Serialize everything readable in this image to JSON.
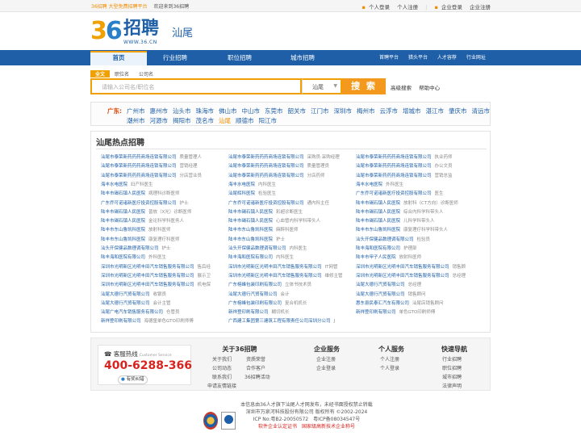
{
  "topbar": {
    "promo": "36招聘 大型免费招聘平台",
    "welcome": "欢迎来到36招聘",
    "personal_login": "个人登录",
    "personal_register": "个人注册",
    "company_login": "企业登录",
    "company_register": "企业注册"
  },
  "logo": {
    "cn": "招聘",
    "url": "WWW.36.CN"
  },
  "city": "汕尾",
  "nav": {
    "tabs": [
      "首页",
      "行业招聘",
      "职位招聘",
      "城市招聘"
    ],
    "right": [
      "首聘平台",
      "猎头平台",
      "人才容荐",
      "行业网址"
    ]
  },
  "search": {
    "tabs": [
      "全文",
      "职位名",
      "公司名"
    ],
    "placeholder": "请输入公司名/职位名",
    "city": "汕尾",
    "button": "搜 索",
    "advanced": "高级搜索",
    "assist": "帮助中心"
  },
  "cities": {
    "label": "广东:",
    "row1": [
      "广州市",
      "惠州市",
      "汕头市",
      "珠海市",
      "佛山市",
      "中山市",
      "东莞市",
      "韶关市",
      "江门市",
      "深圳市",
      "梅州市",
      "云浮市",
      "增城市",
      "湛江市",
      "肇庆市",
      "清远市"
    ],
    "row2": [
      "潮州市",
      "河源市",
      "揭阳市",
      "茂名市",
      "汕尾",
      "顺德市",
      "阳江市"
    ]
  },
  "hot": {
    "title": "汕尾热点招聘",
    "col1": [
      [
        "汕尾市泰荣新药药药商场连锁有限公司",
        "质量管理人"
      ],
      [
        "汕尾市泰荣新药药药商场连锁有限公司",
        "营销经理"
      ],
      [
        "汕尾市泰荣新药药药商场连锁有限公司",
        "分店营业员"
      ],
      [
        "海丰水电医院",
        "妇产科医生"
      ],
      [
        "陆丰市碣石镇人民医院",
        "病理科诊断医师"
      ],
      [
        "广东乔可诺诸新医疗投资控股有限公司",
        "护士"
      ],
      [
        "陆丰市碣石镇人民医院",
        "普放（X光）诊断医师"
      ],
      [
        "陆丰市碣石镇人民医院",
        "金论科学科医务人"
      ],
      [
        "陆丰市东山鲁凯科医院",
        "放射科医师"
      ],
      [
        "陆丰市东山鲁凯科医院",
        "康复理疗科医师"
      ],
      [
        "汕头开保健品数理调有限公司",
        "护士"
      ],
      [
        "陆丰海和医院有限公司",
        "外科医生"
      ],
      [
        "深圳市光明新区光明丰田汽车销售服务有限公司",
        "售后经"
      ],
      [
        "深圳市光明新区光明丰田汽车销售服务有限公司",
        "展示卫"
      ],
      [
        "深圳市光明新区光明丰田汽车销售服务有限公司",
        "机电保"
      ],
      [
        "汕尾大德行汽贸有限公司",
        "收银员"
      ],
      [
        "汕尾大德行汽贸有限公司",
        "会计主管"
      ],
      [
        "汕尾广电汽车销售服务有限公司",
        "仓管员"
      ],
      [
        "新祥登印刷有限公司",
        "海德堡单色GTO印刷师傅"
      ]
    ],
    "col2": [
      [
        "汕尾市泰荣新药药药商场连锁有限公司",
        "采购员·采购经理"
      ],
      [
        "汕尾市泰荣新药药药商场连锁有限公司",
        "质量管理员"
      ],
      [
        "汕尾市泰荣新药药药商场连锁有限公司",
        "分店药师"
      ],
      [
        "海丰水电医院",
        "内科医生"
      ],
      [
        "汕尾辉科医院",
        "检验医生"
      ],
      [
        "广东乔可诺诸新医疗投资控股有限公司",
        "通内科主任"
      ],
      [
        "陆丰市碣石镇人民医院",
        "彩超诊断医生"
      ],
      [
        "陆丰市碣石镇人民医院",
        "心血管内科学科带头人"
      ],
      [
        "陆丰市东山鲁凯科医院",
        "麻醉科医师"
      ],
      [
        "陆丰市东山鲁凯科医院",
        "护士"
      ],
      [
        "汕头开保健品数理调有限公司",
        "内科医生"
      ],
      [
        "陆丰海和医院有限公司",
        "内科医生"
      ],
      [
        "深圳市光明新区光明丰田汽车销售服务有限公司",
        "IT网管"
      ],
      [
        "深圳市光明新区光明丰田汽车销售服务有限公司",
        "维修主管"
      ],
      [
        "广东榕峰包装印刷有限公司",
        "立体书技术员"
      ],
      [
        "汕尾大德行汽贸有限公司",
        "会计"
      ],
      [
        "广东榕峰包装印刷有限公司",
        "复合机机长"
      ],
      [
        "新祥登印刷有限公司",
        "糊切机长"
      ],
      [
        "广西建工集团第三建筑工程有限责任公司深圳分公司",
        "J"
      ]
    ],
    "col3": [
      [
        "汕尾市泰荣新药药药商场连锁有限公司",
        "执业药师"
      ],
      [
        "汕尾市泰荣新药药药商场连锁有限公司",
        "办公文员"
      ],
      [
        "汕尾市泰荣新药药药商场连锁有限公司",
        "营销总监"
      ],
      [
        "海丰水电医院",
        "外科医生"
      ],
      [
        "广东乔可诺诸新医疗投资控股有限公司",
        "医生"
      ],
      [
        "陆丰市碣石镇人民医院",
        "放射科（CT方向）诊断医师"
      ],
      [
        "陆丰市碣石镇人民医院",
        "综合内科学科带头人"
      ],
      [
        "陆丰市碣石镇人民医院",
        "儿科学科带头人"
      ],
      [
        "陆丰市东山鲁凯科医院",
        "康复理疗科学科带头人"
      ],
      [
        "汕头开保健品数理调有限公司",
        "检验员"
      ],
      [
        "陆丰海和医院有限公司",
        "护理部"
      ],
      [
        "陆丰市甲子人民医院",
        "放射科医师"
      ],
      [
        "深圳市光明新区光明丰田汽车销售服务有限公司",
        "销售顾"
      ],
      [
        "深圳市光明新区光明丰田汽车销售服务有限公司",
        "总经理"
      ],
      [
        "汕尾大德行汽贸有限公司",
        "总经理"
      ],
      [
        "汕尾大德行汽贸有限公司",
        "销售顾问"
      ],
      [
        "惠东县民泰汇汽车有限公司",
        "汕尾店销售顾问"
      ],
      [
        "新祥登印刷有限公司",
        "单色GTO印刷师傅"
      ]
    ]
  },
  "footer": {
    "hotline_title": "客服热线",
    "hotline_en": "Customer Service",
    "hotline_number": "400-6288-366",
    "qq": "有奖纠错",
    "about": {
      "title": "关于36招聘",
      "items": [
        "关于我们",
        "资质荣誉",
        "公司动态",
        "合作客户",
        "联系我们",
        "36招聘活动",
        "申请友情链接"
      ]
    },
    "company": {
      "title": "企业服务",
      "items": [
        "企业注册",
        "企业登录"
      ]
    },
    "personal": {
      "title": "个人服务",
      "items": [
        "个人注册",
        "个人登录"
      ]
    },
    "quick": {
      "title": "快速导航",
      "items": [
        "行业招聘",
        "职位招聘",
        "城市招聘",
        "法律声明"
      ]
    }
  },
  "copyright": {
    "line1": "本信息由36人才旗下汕尾人才网发布，未经书面授权禁止转载",
    "line2": "深圳市万泉河科技股份有限公司 版权所有 ©2002-2024",
    "line3": "ICP No:粤B2-20050572　粤ICP备08034547号",
    "line4": "软件企业认定证书　国家级高新技术企业称号"
  }
}
